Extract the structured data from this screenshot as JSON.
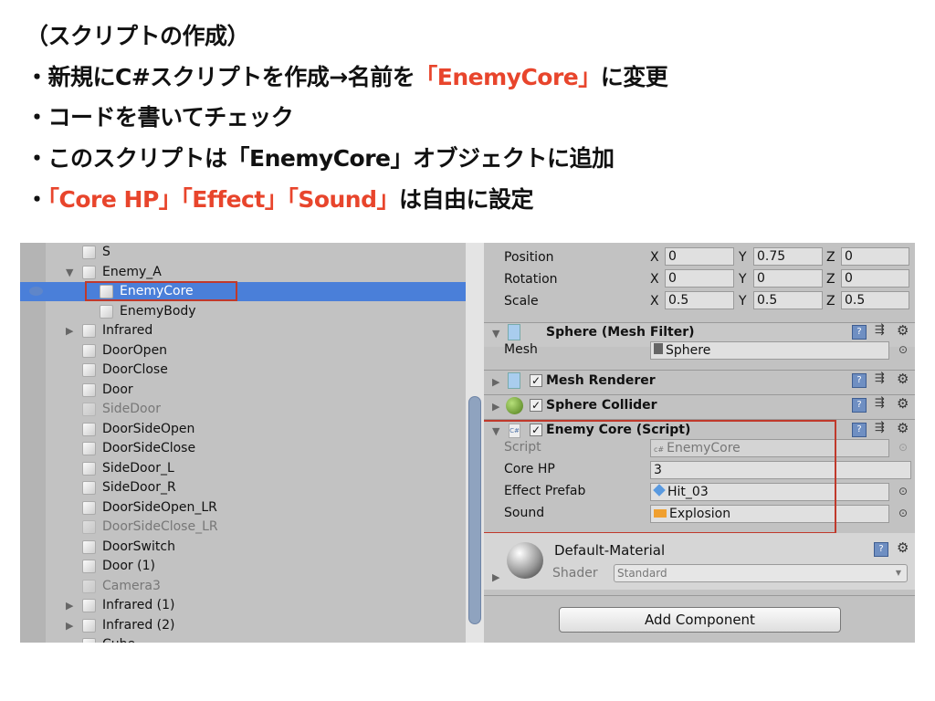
{
  "slide": {
    "lines": [
      {
        "text": "（スクリプトの作成）"
      },
      {
        "bullet": "・",
        "parts": [
          {
            "text": "新規にC#スクリプトを作成→名前を",
            "red": false
          },
          {
            "text": "「EnemyCore」",
            "red": true
          },
          {
            "text": "に変更",
            "red": false
          }
        ]
      },
      {
        "bullet": "・",
        "parts": [
          {
            "text": "コードを書いてチェック",
            "red": false
          }
        ]
      },
      {
        "bullet": "・",
        "parts": [
          {
            "text": "このスクリプトは「EnemyCore」オブジェクトに追加",
            "red": false
          }
        ]
      },
      {
        "bullet": "・",
        "parts": [
          {
            "text": "「Core HP」「Effect」「Sound」",
            "red": true
          },
          {
            "text": "は自由に設定",
            "red": false
          }
        ]
      }
    ],
    "accent_color": "#e8452c"
  },
  "hierarchy": {
    "items": [
      {
        "label": "S",
        "level": 1,
        "expander": "",
        "dim": false
      },
      {
        "label": "Enemy_A",
        "level": 1,
        "expander": "expanded",
        "dim": false
      },
      {
        "label": "EnemyCore",
        "level": 2,
        "expander": "",
        "dim": false,
        "selected": true
      },
      {
        "label": "EnemyBody",
        "level": 2,
        "expander": "",
        "dim": false
      },
      {
        "label": "Infrared",
        "level": 1,
        "expander": "collapsed",
        "dim": false
      },
      {
        "label": "DoorOpen",
        "level": 1,
        "expander": "",
        "dim": false
      },
      {
        "label": "DoorClose",
        "level": 1,
        "expander": "",
        "dim": false
      },
      {
        "label": "Door",
        "level": 1,
        "expander": "",
        "dim": false
      },
      {
        "label": "SideDoor",
        "level": 1,
        "expander": "",
        "dim": true
      },
      {
        "label": "DoorSideOpen",
        "level": 1,
        "expander": "",
        "dim": false
      },
      {
        "label": "DoorSideClose",
        "level": 1,
        "expander": "",
        "dim": false
      },
      {
        "label": "SideDoor_L",
        "level": 1,
        "expander": "",
        "dim": false
      },
      {
        "label": "SideDoor_R",
        "level": 1,
        "expander": "",
        "dim": false
      },
      {
        "label": "DoorSideOpen_LR",
        "level": 1,
        "expander": "",
        "dim": false
      },
      {
        "label": "DoorSideClose_LR",
        "level": 1,
        "expander": "",
        "dim": true
      },
      {
        "label": "DoorSwitch",
        "level": 1,
        "expander": "",
        "dim": false
      },
      {
        "label": "Door (1)",
        "level": 1,
        "expander": "",
        "dim": false
      },
      {
        "label": "Camera3",
        "level": 1,
        "expander": "",
        "dim": true
      },
      {
        "label": "Infrared (1)",
        "level": 1,
        "expander": "collapsed",
        "dim": false
      },
      {
        "label": "Infrared (2)",
        "level": 1,
        "expander": "collapsed",
        "dim": false
      },
      {
        "label": "Cube",
        "level": 1,
        "expander": "",
        "dim": false
      }
    ]
  },
  "inspector": {
    "transform": {
      "rows": [
        {
          "label": "Position",
          "x": "0",
          "y": "0.75",
          "z": "0"
        },
        {
          "label": "Rotation",
          "x": "0",
          "y": "0",
          "z": "0"
        },
        {
          "label": "Scale",
          "x": "0.5",
          "y": "0.5",
          "z": "0.5"
        }
      ],
      "axis": {
        "x": "X",
        "y": "Y",
        "z": "Z"
      }
    },
    "mesh_filter": {
      "title": "Sphere (Mesh Filter)",
      "mesh_label": "Mesh",
      "mesh_value": "Sphere"
    },
    "mesh_renderer": {
      "title": "Mesh Renderer",
      "enabled": true
    },
    "sphere_collider": {
      "title": "Sphere Collider",
      "enabled": true
    },
    "enemy_core": {
      "title": "Enemy Core (Script)",
      "icon_text": "C#",
      "enabled": true,
      "script_label": "Script",
      "script_value": "EnemyCore",
      "core_hp_label": "Core HP",
      "core_hp_value": "3",
      "effect_label": "Effect Prefab",
      "effect_value": "Hit_03",
      "sound_label": "Sound",
      "sound_value": "Explosion"
    },
    "material": {
      "name": "Default-Material",
      "shader_label": "Shader",
      "shader_value": "Standard"
    },
    "add_component": "Add Component",
    "help_glyph": "?",
    "check_glyph": "✓"
  }
}
